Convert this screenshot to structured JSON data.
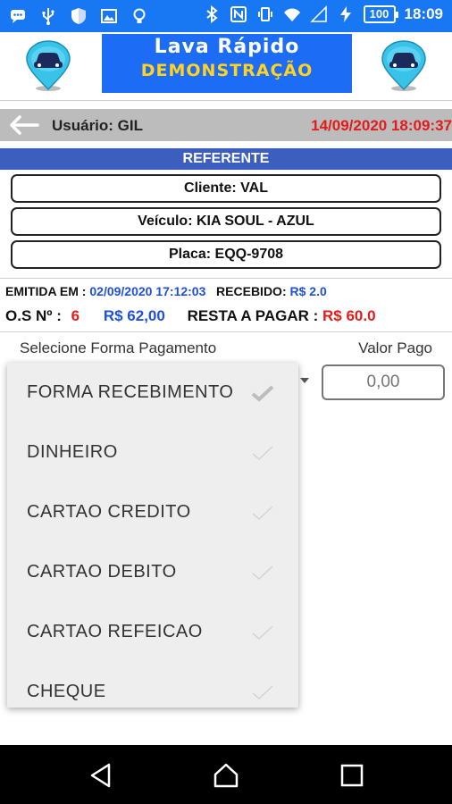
{
  "status_bar": {
    "battery": "100",
    "time": "18:09",
    "left_icons": [
      "messages-icon",
      "usb-icon",
      "shield-icon",
      "gallery-icon",
      "bulb-icon"
    ],
    "right_icons": [
      "bluetooth-icon",
      "nfc-icon",
      "vibrate-icon",
      "wifi-icon",
      "signal-icon",
      "charging-icon"
    ]
  },
  "header": {
    "title": "Lava Rápido",
    "subtitle": "DEMONSTRAÇÃO",
    "logo_icon": "car-pin-icon"
  },
  "user_bar": {
    "user": "Usuário: GIL",
    "datetime": "14/09/2020 18:09:37"
  },
  "referente": {
    "title": "REFERENTE",
    "cliente": "Cliente: VAL",
    "veiculo": "Veículo: KIA SOUL - AZUL",
    "placa": "Placa: EQQ-9708"
  },
  "info": {
    "emitida_label": "EMITIDA EM :",
    "emitida_value": "02/09/2020 17:12:03",
    "recebido_label": "RECEBIDO:",
    "recebido_value": "R$ 2.0",
    "os_label": "O.S Nº :",
    "os_value": "6",
    "total": "R$ 62,00",
    "resta_label": "RESTA A PAGAR :",
    "resta_value": "R$ 60.0"
  },
  "payment": {
    "select_label": "Selecione Forma Pagamento",
    "valor_label": "Valor Pago",
    "valor_value": "0,00",
    "options": [
      "FORMA RECEBIMENTO",
      "DINHEIRO",
      "CARTAO CREDITO",
      "CARTAO DEBITO",
      "CARTAO REFEICAO",
      "CHEQUE"
    ]
  },
  "colors": {
    "status_bar": "#1877f2",
    "banner": "#1c6cf5",
    "subtitle": "#ffd320",
    "ref_bar": "#3c5fbf",
    "accent_red": "#e21c1c",
    "accent_blue": "#1f4fe0"
  }
}
